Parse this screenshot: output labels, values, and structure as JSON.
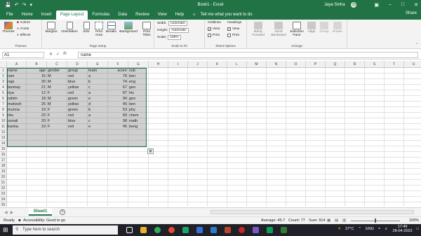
{
  "titlebar": {
    "autosave": "AutoSave",
    "doc_title": "Book1 - Excel",
    "user": "Jaya Sinha",
    "avatar": "JS"
  },
  "tabs": [
    "File",
    "Home",
    "Insert",
    "Page Layout",
    "Formulas",
    "Data",
    "Review",
    "View",
    "Help"
  ],
  "active_tab": "Page Layout",
  "tell_me": "Tell me what you want to do",
  "share": "Share",
  "ribbon": {
    "themes": {
      "label": "Themes",
      "themes_btn": "Themes",
      "colors": "Colors",
      "fonts": "Fonts",
      "effects": "Effects"
    },
    "page_setup": {
      "label": "Page Setup",
      "margins": "Margins",
      "orientation": "Orientation",
      "size": "Size",
      "print_area": "Print Area",
      "breaks": "Breaks",
      "background": "Background",
      "print_titles": "Print Titles"
    },
    "scale": {
      "label": "Scale to Fit",
      "width_label": "Width:",
      "width_value": "Automatic",
      "height_label": "Height:",
      "height_value": "Automatic",
      "scale_label": "Scale:",
      "scale_value": "100%"
    },
    "sheet_options": {
      "label": "Sheet Options",
      "gridlines": "Gridlines",
      "headings": "Headings",
      "view": "View",
      "print": "Print"
    },
    "arrange": {
      "label": "Arrange",
      "bring_forward": "Bring Forward",
      "send_backward": "Send Backward",
      "selection_pane": "Selection Pane",
      "align": "Align",
      "group": "Group",
      "rotate": "Rotate"
    }
  },
  "formula_bar": {
    "name_box": "A1",
    "content": "name"
  },
  "columns": [
    "A",
    "B",
    "C",
    "D",
    "E",
    "F",
    "G",
    "H",
    "I",
    "J",
    "K",
    "L",
    "M",
    "N",
    "O",
    "P",
    "Q",
    "R",
    "S",
    "T",
    "U"
  ],
  "rows": [
    "1",
    "2",
    "3",
    "4",
    "5",
    "6",
    "7",
    "8",
    "9",
    "10",
    "11",
    "12",
    "13",
    "14",
    "15",
    "16",
    "17",
    "18",
    "19",
    "20",
    "21",
    "22",
    "23",
    "24",
    "25"
  ],
  "headers": [
    "name",
    "age",
    "gender",
    "group",
    "team",
    "score",
    "sub"
  ],
  "table": [
    [
      "ram",
      "15",
      "M",
      "red",
      "a",
      "76",
      "ben"
    ],
    [
      "raja",
      "20",
      "M",
      "blue",
      "b",
      "74",
      "eng"
    ],
    [
      "tanmay",
      "21",
      "M",
      "yellow",
      "c",
      "67",
      "geo"
    ],
    [
      "riya",
      "12",
      "F",
      "red",
      "a",
      "87",
      "his"
    ],
    [
      "rahim",
      "18",
      "M",
      "green",
      "e",
      "94",
      "geo"
    ],
    [
      "mahesh",
      "25",
      "M",
      "yellow",
      "d",
      "45",
      "ben"
    ],
    [
      "munna",
      "19",
      "F",
      "green",
      "b",
      "53",
      "phy"
    ],
    [
      "rita",
      "23",
      "F",
      "red",
      "a",
      "83",
      "chem"
    ],
    [
      "sonali",
      "20",
      "F",
      "blue",
      "c",
      "98",
      "math"
    ],
    [
      "karina",
      "19",
      "F",
      "red",
      "e",
      "45",
      "beng"
    ]
  ],
  "sheet_tab": "Sheet1",
  "status": {
    "ready": "Ready",
    "accessibility": "Accessibility: Good to go",
    "average": "Average: 45.7",
    "count": "Count: 77",
    "sum": "Sum: 914",
    "zoom": "100%"
  },
  "taskbar": {
    "search": "Type here to search",
    "weather": "37°C",
    "lang": "ENG",
    "time": "17:49",
    "date": "28-04-2022"
  },
  "colors": {
    "excel_green": "#217346",
    "selection": "#6e6e6e",
    "taskbar": "#1f2028"
  }
}
